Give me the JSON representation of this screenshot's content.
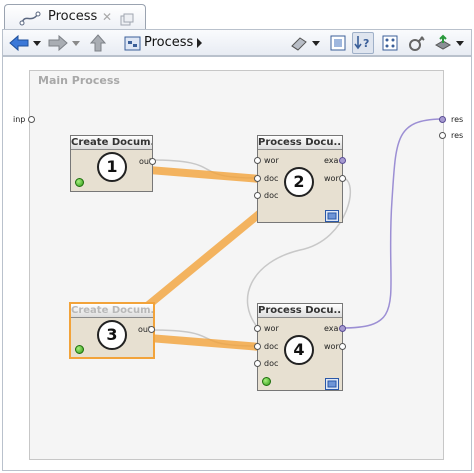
{
  "tab": {
    "title": "Process",
    "icon": "process-flow-icon",
    "close_glyph": "✕"
  },
  "toolbar": {
    "back": "arrow-left-icon",
    "forward": "arrow-right-icon",
    "up": "arrow-up-icon",
    "breadcrumb": "Process",
    "icons": [
      "eraser-icon",
      "fit-page-icon",
      "auto-wire-icon",
      "arrange-icon",
      "plugin-icon",
      "export-icon"
    ]
  },
  "process": {
    "title": "Main Process",
    "inner_source": "inp",
    "inner_sinks": [
      "res",
      "res"
    ]
  },
  "operators": [
    {
      "title": "Create Docum...",
      "ports_in": [],
      "ports_out": [
        "out"
      ],
      "badge": "1"
    },
    {
      "title": "Process Docu...",
      "ports_in": [
        "wor",
        "doc",
        "doc"
      ],
      "ports_out": [
        "exa",
        "wor"
      ],
      "badge": "2"
    },
    {
      "title": "Create Docum...",
      "ports_in": [],
      "ports_out": [
        "out"
      ],
      "badge": "3"
    },
    {
      "title": "Process Docu...",
      "ports_in": [
        "wor",
        "doc",
        "doc"
      ],
      "ports_out": [
        "exa",
        "wor"
      ],
      "badge": "4"
    }
  ],
  "colors": {
    "highlight": "#f2a33a",
    "wire": "#c8c8c8",
    "result_wire": "#9c8fd4",
    "operator_body": "#e7e0d1"
  }
}
